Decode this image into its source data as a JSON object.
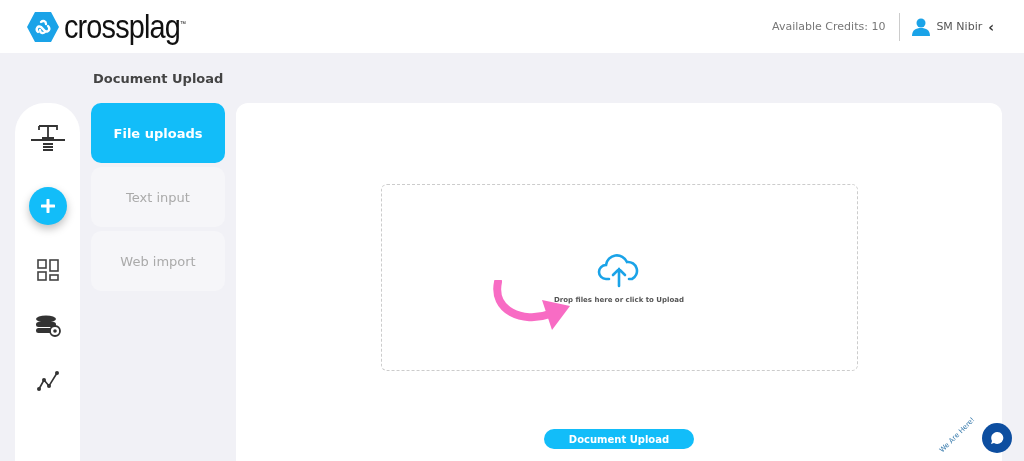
{
  "header": {
    "logo": "crossplag",
    "logo_mark": "™",
    "credits": "Available Credits: 10",
    "user": "SM Nibir",
    "user_caret": "‹"
  },
  "page_title": "Document Upload",
  "sidebar": {
    "items": [
      {
        "kind": "text",
        "selected": false
      },
      {
        "kind": "add",
        "selected": true
      },
      {
        "kind": "grid",
        "selected": false
      },
      {
        "kind": "database",
        "selected": false
      },
      {
        "kind": "chart",
        "selected": false
      }
    ]
  },
  "tabs": [
    {
      "label": "File uploads",
      "selected": true
    },
    {
      "label": "Text input",
      "selected": false
    },
    {
      "label": "Web import",
      "selected": false
    }
  ],
  "dropzone": {
    "text": "Drop files here or click to Upload"
  },
  "submit": "Document Upload",
  "chat": {
    "badge": "We Are Here!"
  }
}
